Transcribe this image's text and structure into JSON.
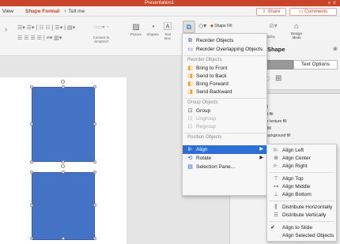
{
  "window": {
    "document_title": "Presentation1"
  },
  "tabs": {
    "view": "View",
    "shape_format": "Shape Format",
    "tell_me": "Tell me"
  },
  "header_actions": {
    "share": "Share",
    "comments": "Comments"
  },
  "toolbar": {
    "convert_to_smartart": "Convert to SmartArt",
    "picture": "Picture",
    "shapes": "Shapes",
    "text_box": "Text Box",
    "shape_fill": "Shape Fill",
    "accessibility": "ibility",
    "design_ideas": "Design Ideas"
  },
  "format_pane": {
    "title": "Shape",
    "tab_shape_options": "",
    "tab_text_options": "Text Options",
    "fill_lines": [
      "l",
      "t fill",
      "r texture fill",
      "fill",
      "ackground fill"
    ]
  },
  "arrange_menu": {
    "top_items": [
      {
        "label": "Reorder Objects"
      },
      {
        "label": "Reorder Overlapping Objects"
      }
    ],
    "reorder_section": "Reorder Objects",
    "reorder_items": [
      "Bring to Front",
      "Send to Back",
      "Bring Forward",
      "Send Backward"
    ],
    "group_section": "Group Objects",
    "group_items": [
      {
        "label": "Group",
        "enabled": true
      },
      {
        "label": "Ungroup",
        "enabled": false
      },
      {
        "label": "Regroup",
        "enabled": false
      }
    ],
    "position_section": "Position Objects",
    "position_items": [
      {
        "label": "Align",
        "highlighted": true,
        "has_submenu": true
      },
      {
        "label": "Rotate",
        "highlighted": false,
        "has_submenu": true
      },
      {
        "label": "Selection Pane...",
        "highlighted": false,
        "has_submenu": false
      }
    ]
  },
  "align_submenu": {
    "items": [
      "Align Left",
      "Align Center",
      "Align Right",
      "Align Top",
      "Align Middle",
      "Align Bottom",
      "Distribute Horizontally",
      "Distribute Vertically",
      "Align to Slide",
      "Align Selected Objects"
    ],
    "checked": "Align to Slide"
  },
  "colors": {
    "accent": "#c8442a",
    "shape_fill": "#4472c4",
    "menu_highlight": "#2e6fd6"
  }
}
